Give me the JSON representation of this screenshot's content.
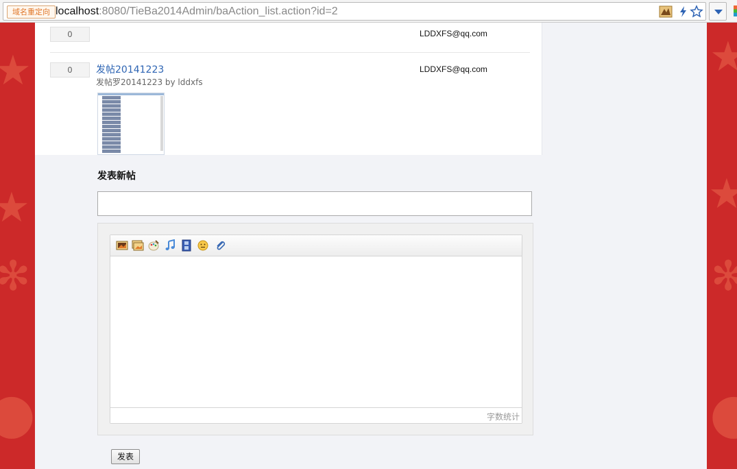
{
  "browser": {
    "redirect_label": "域名重定向",
    "url_host": "localhost",
    "url_rest": ":8080/TieBa2014Admin/baAction_list.action?id=2",
    "icons": [
      "extension-icon",
      "lightning-icon",
      "star-icon",
      "menu-dropdown-icon"
    ]
  },
  "posts": [
    {
      "count": "0",
      "email": "LDDXFS@qq.com"
    },
    {
      "count": "0",
      "email": "LDDXFS@qq.com",
      "title": "发帖20141223",
      "subtitle": "发帖罗20141223 by lddxfs",
      "has_thumbnail": true
    }
  ],
  "new_post": {
    "heading": "发表新帖",
    "title_value": "",
    "body_value": "",
    "toolbar_icons": [
      "image-icon",
      "multi-image-icon",
      "paint-icon",
      "music-icon",
      "video-icon",
      "emoticon-icon",
      "attachment-icon"
    ],
    "word_count_label": "字数统计",
    "submit_label": "发表"
  },
  "colors": {
    "background_red": "#cc2929",
    "link_blue": "#2d64b3",
    "panel_bg": "#f2f3f7"
  }
}
